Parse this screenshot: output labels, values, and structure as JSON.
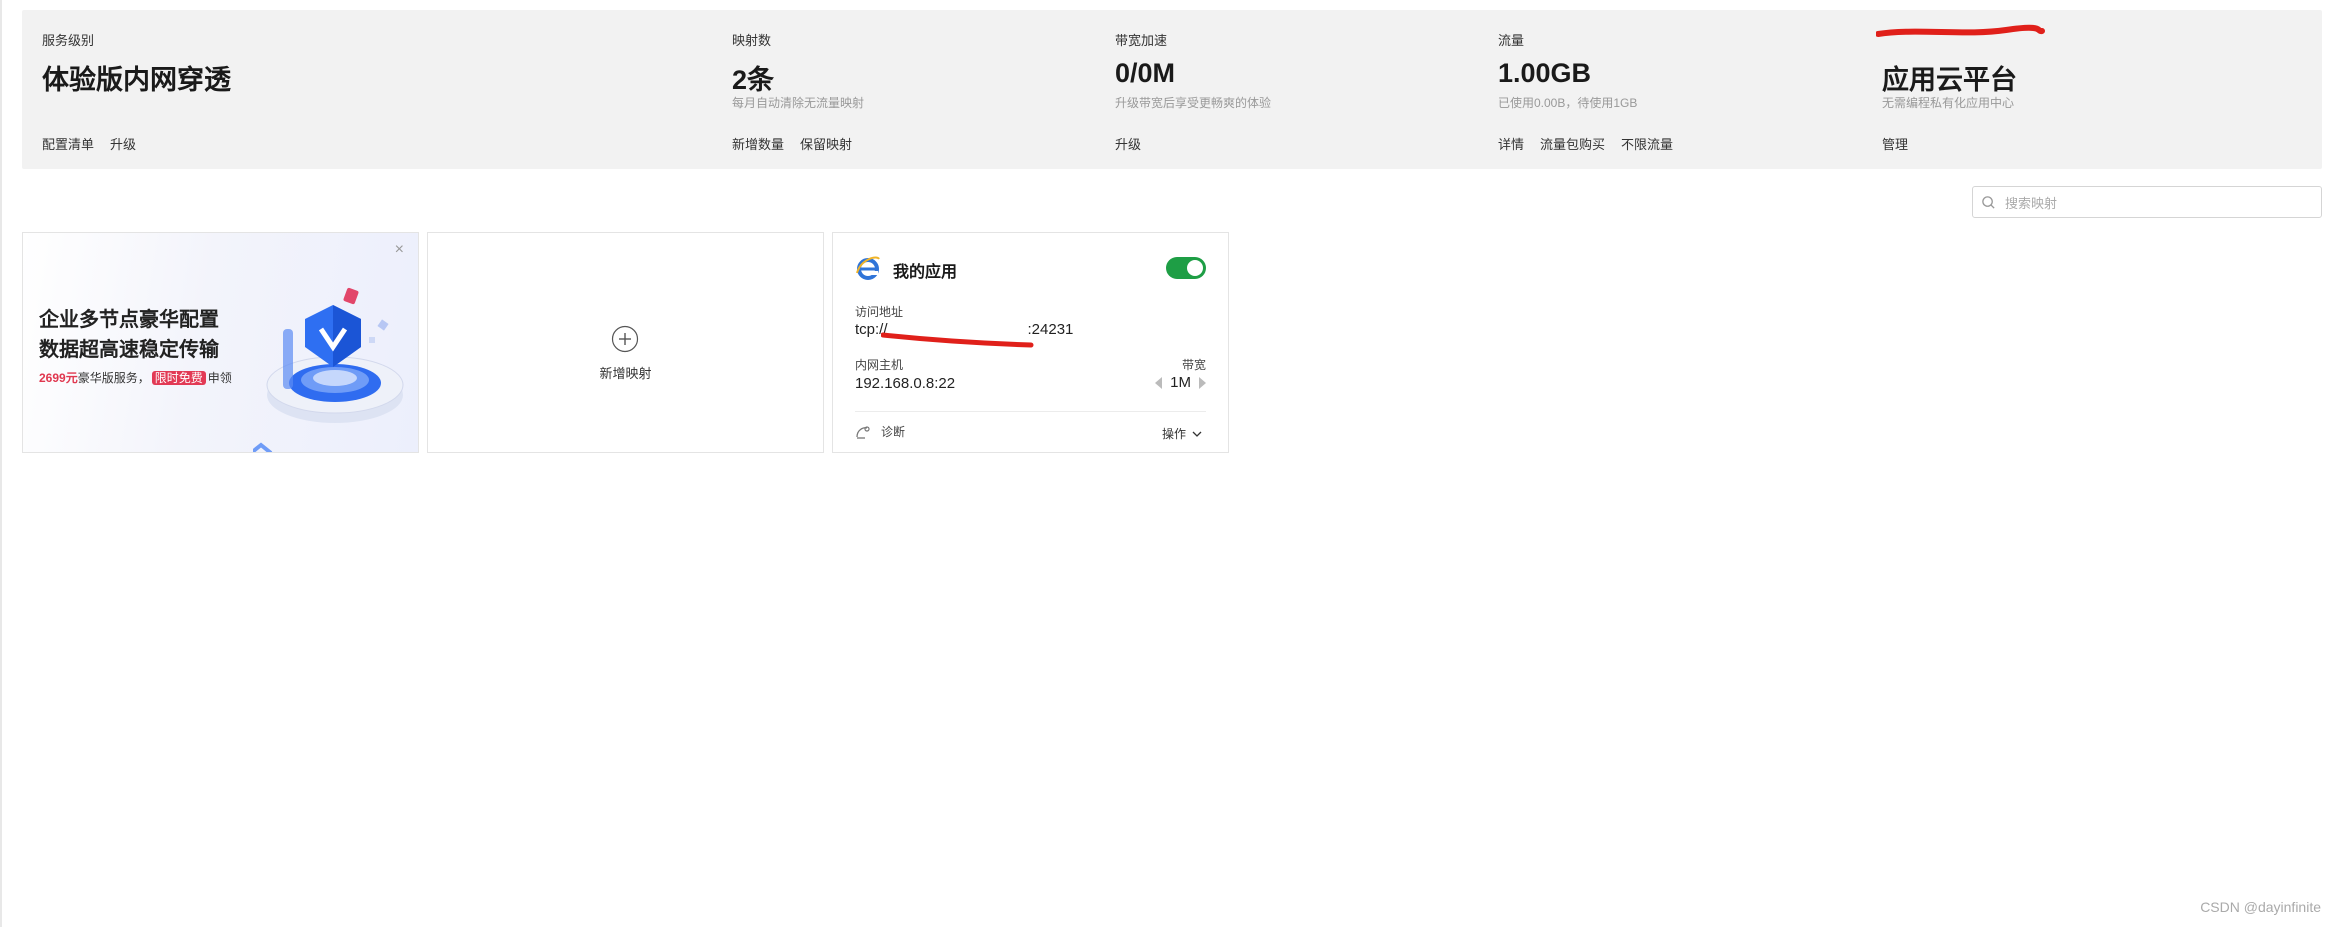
{
  "summary": {
    "service_level": {
      "label": "服务级别",
      "value": "体验版内网穿透",
      "actions": [
        "配置清单",
        "升级"
      ]
    },
    "mappings": {
      "label": "映射数",
      "value": "2条",
      "sub": "每月自动清除无流量映射",
      "actions": [
        "新增数量",
        "保留映射"
      ]
    },
    "bandwidth": {
      "label": "带宽加速",
      "value": "0/0M",
      "sub": "升级带宽后享受更畅爽的体验",
      "actions": [
        "升级"
      ]
    },
    "traffic": {
      "label": "流量",
      "value": "1.00GB",
      "sub": "已使用0.00B，待使用1GB",
      "actions": [
        "详情",
        "流量包购买",
        "不限流量"
      ]
    },
    "cloud": {
      "label": "",
      "value": "应用云平台",
      "sub": "无需编程私有化应用中心",
      "actions": [
        "管理"
      ]
    }
  },
  "search": {
    "placeholder": "搜索映射",
    "value": ""
  },
  "promo": {
    "title_line1": "企业多节点豪华配置",
    "title_line2": "数据超高速稳定传输",
    "price": "2699元",
    "text_mid": "豪华版服务，",
    "tag": "限时免费",
    "text_end": "申领",
    "close_icon": "×"
  },
  "add_card": {
    "label": "新增映射"
  },
  "app_card": {
    "name": "我的应用",
    "enabled": true,
    "address_label": "访问地址",
    "address_prefix": "tcp://",
    "address_suffix": ":24231",
    "host_label": "内网主机",
    "host": "192.168.0.8:22",
    "bandwidth_label": "带宽",
    "bandwidth": "1M",
    "diagnose_label": "诊断",
    "ops_label": "操作"
  },
  "footer": {
    "credit": "CSDN @dayinfinite"
  },
  "colors": {
    "panel_bg": "#f2f2f2",
    "toggle_on": "#1e9e45",
    "promo_red": "#e23a55",
    "redaction": "#e0201a"
  }
}
